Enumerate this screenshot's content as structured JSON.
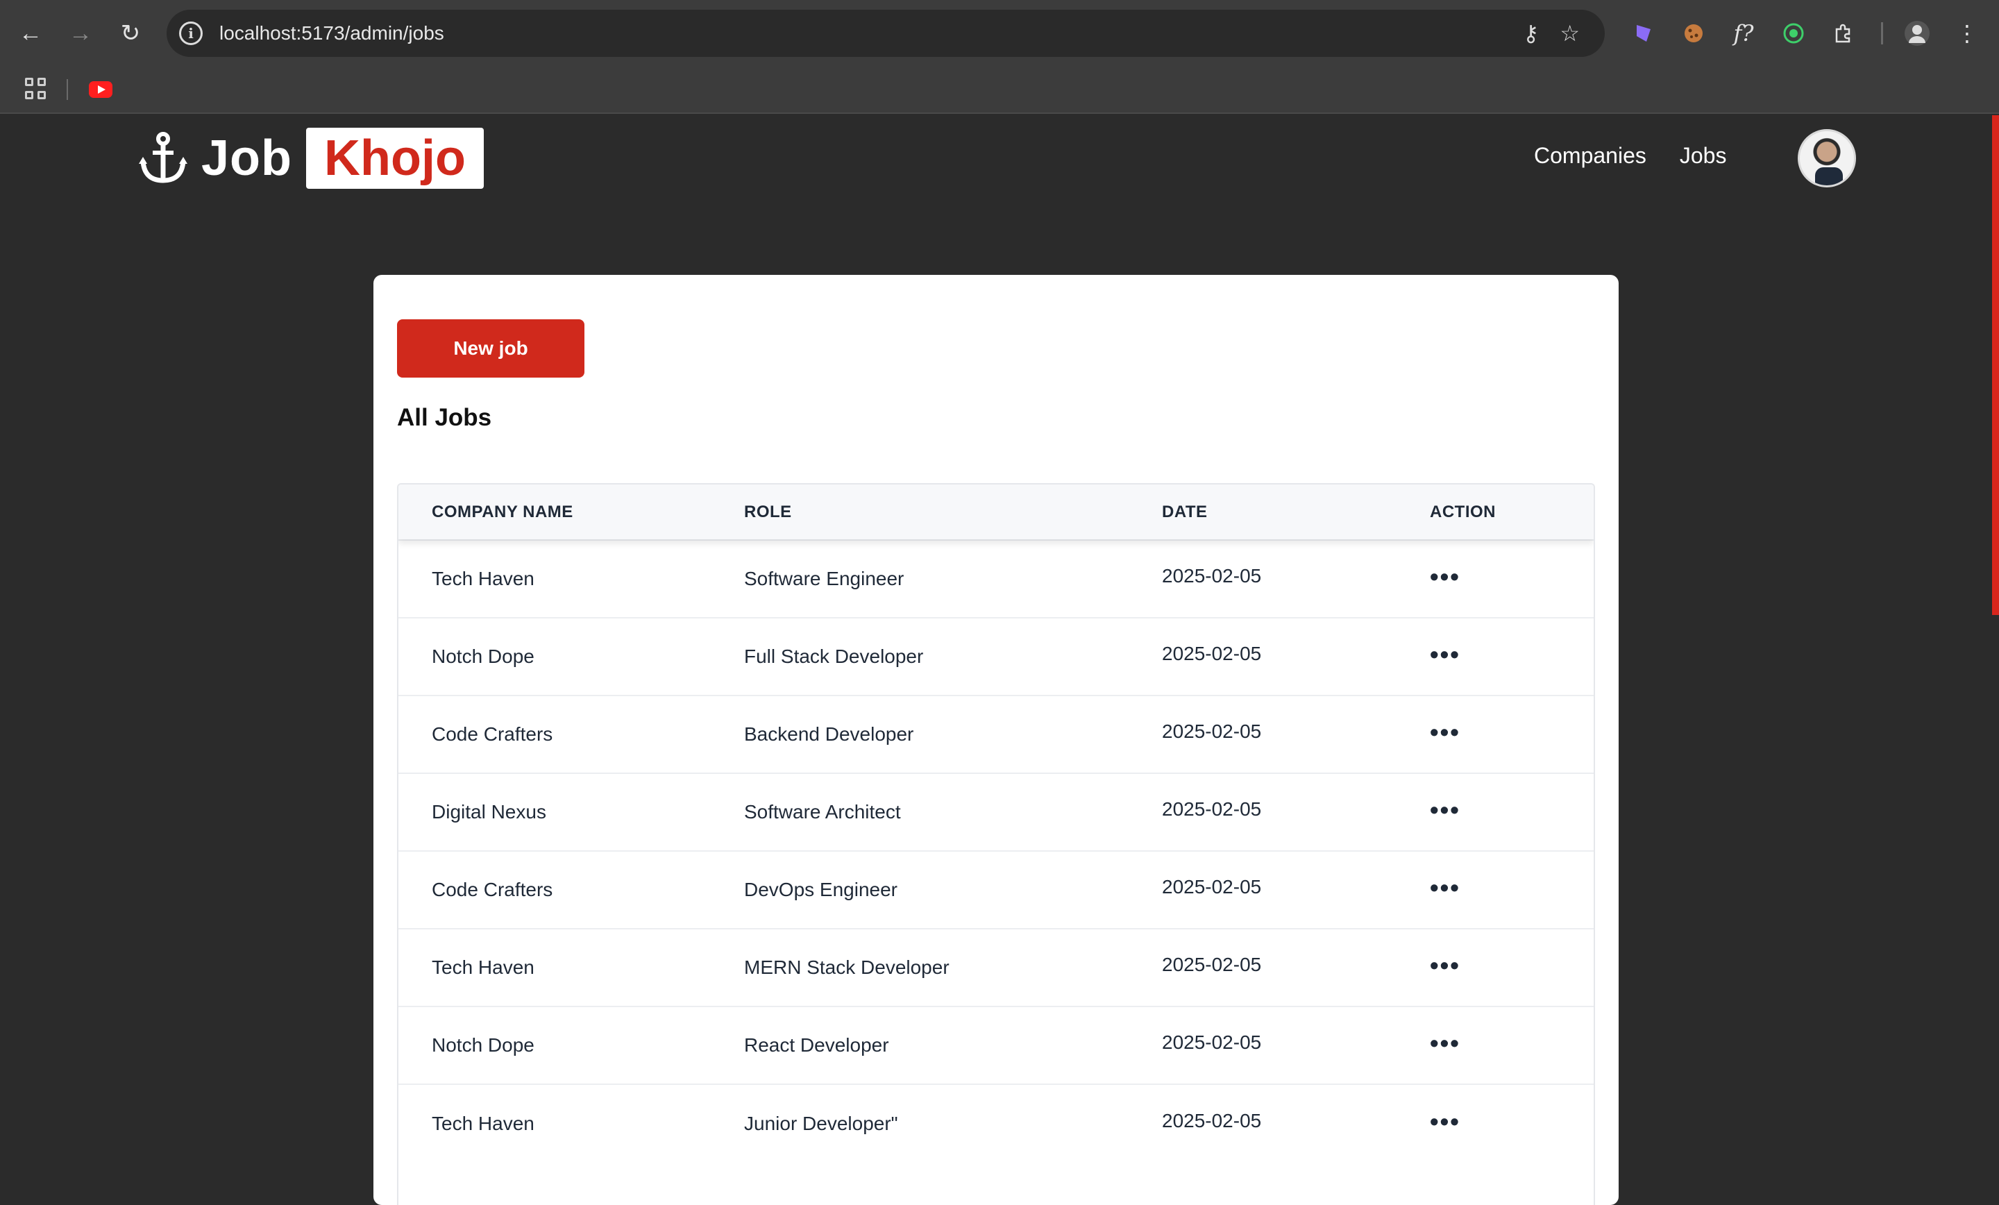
{
  "browser": {
    "url": "localhost:5173/admin/jobs"
  },
  "app": {
    "logo_part1": "Job",
    "logo_part2": "Khojo",
    "nav": [
      {
        "label": "Companies"
      },
      {
        "label": "Jobs"
      }
    ]
  },
  "page": {
    "new_job_label": "New job",
    "title": "All Jobs",
    "table": {
      "headers": [
        "COMPANY NAME",
        "ROLE",
        "DATE",
        "ACTION"
      ],
      "rows": [
        {
          "company": "Tech Haven",
          "role": "Software Engineer",
          "date": "2025-02-05",
          "action": "•••"
        },
        {
          "company": "Notch Dope",
          "role": "Full Stack Developer",
          "date": "2025-02-05",
          "action": "•••"
        },
        {
          "company": "Code Crafters",
          "role": "Backend Developer",
          "date": "2025-02-05",
          "action": "•••"
        },
        {
          "company": "Digital Nexus",
          "role": "Software Architect",
          "date": "2025-02-05",
          "action": "•••"
        },
        {
          "company": "Code Crafters",
          "role": "DevOps Engineer",
          "date": "2025-02-05",
          "action": "•••"
        },
        {
          "company": "Tech Haven",
          "role": "MERN Stack Developer",
          "date": "2025-02-05",
          "action": "•••"
        },
        {
          "company": "Notch Dope",
          "role": "React Developer",
          "date": "2025-02-05",
          "action": "•••"
        },
        {
          "company": "Tech Haven",
          "role": "Junior Developer\"",
          "date": "2025-02-05",
          "action": "•••"
        }
      ]
    }
  },
  "colors": {
    "brand_red": "#d0291c",
    "page_bg": "#2b2b2b"
  }
}
